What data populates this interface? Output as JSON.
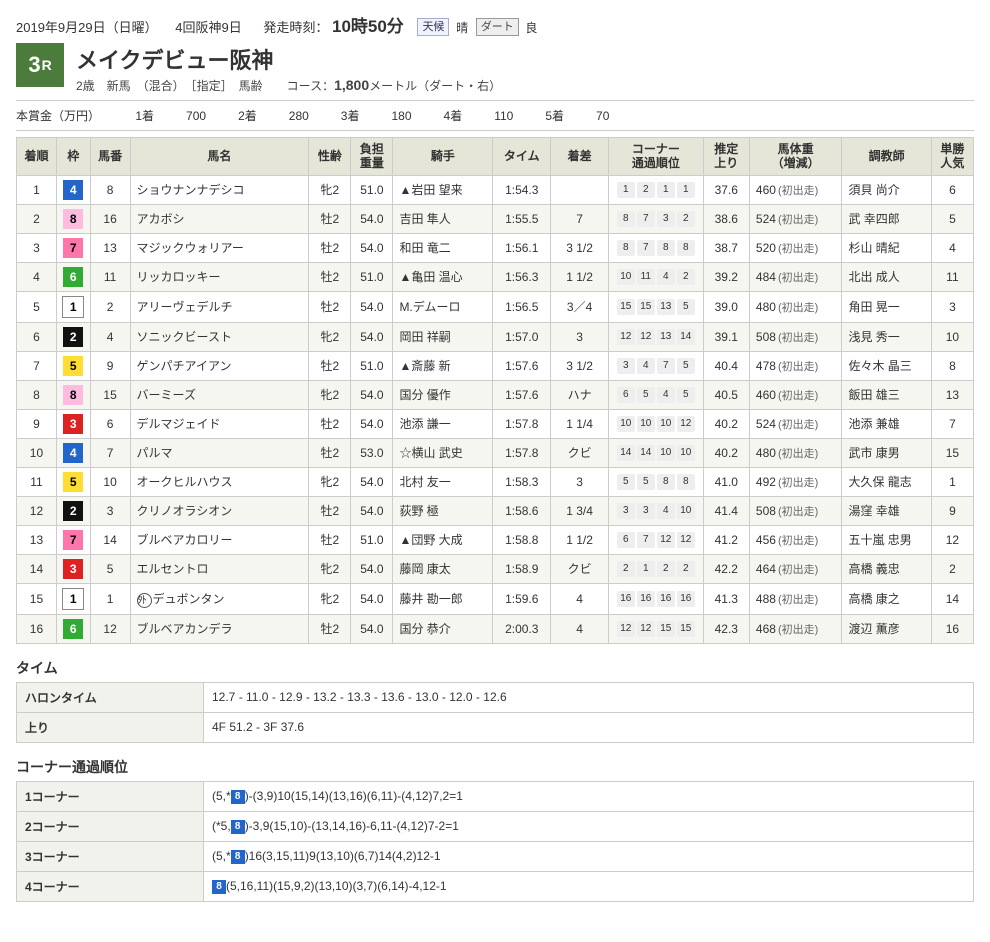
{
  "header": {
    "date": "2019年9月29日（日曜）",
    "meeting": "4回阪神9日",
    "post_label": "発走時刻：",
    "post_time": "10時50分",
    "weather_label": "天候",
    "weather": "晴",
    "surface_label": "ダート",
    "condition": "良"
  },
  "race": {
    "number": "3",
    "suffix": "R",
    "name": "メイクデビュー阪神",
    "subline_pre": "2歳　新馬　（混合）　［指定］　馬齢　　コース：",
    "distance": "1,800",
    "subline_post": "メートル（ダート・右）"
  },
  "prize": {
    "label": "本賞金（万円）",
    "items": [
      {
        "place": "1着",
        "amount": "700"
      },
      {
        "place": "2着",
        "amount": "280"
      },
      {
        "place": "3着",
        "amount": "180"
      },
      {
        "place": "4着",
        "amount": "110"
      },
      {
        "place": "5着",
        "amount": "70"
      }
    ]
  },
  "columns": {
    "finish": "着順",
    "waku": "枠",
    "num": "馬番",
    "name": "馬名",
    "sexage": "性齢",
    "weight": "負担\n重量",
    "jockey": "騎手",
    "time": "タイム",
    "margin": "着差",
    "corner": "コーナー\n通過順位",
    "last": "推定\n上り",
    "bw": "馬体重\n（増減）",
    "trainer": "調教師",
    "pop": "単勝\n人気"
  },
  "rows": [
    {
      "finish": "1",
      "waku": "4",
      "num": "8",
      "name": "ショウナンナデシコ",
      "sexage": "牝2",
      "wt": "51.0",
      "jockey": "▲岩田 望来",
      "time": "1:54.3",
      "margin": "",
      "corner": [
        "1",
        "2",
        "1",
        "1"
      ],
      "last": "37.6",
      "bw": "460",
      "bwnote": "(初出走)",
      "trainer": "須貝 尚介",
      "pop": "6"
    },
    {
      "finish": "2",
      "waku": "8",
      "num": "16",
      "name": "アカボシ",
      "sexage": "牡2",
      "wt": "54.0",
      "jockey": "吉田 隼人",
      "time": "1:55.5",
      "margin": "7",
      "corner": [
        "8",
        "7",
        "3",
        "2"
      ],
      "last": "38.6",
      "bw": "524",
      "bwnote": "(初出走)",
      "trainer": "武 幸四郎",
      "pop": "5"
    },
    {
      "finish": "3",
      "waku": "7",
      "num": "13",
      "name": "マジックウォリアー",
      "sexage": "牡2",
      "wt": "54.0",
      "jockey": "和田 竜二",
      "time": "1:56.1",
      "margin": "3 1/2",
      "corner": [
        "8",
        "7",
        "8",
        "8"
      ],
      "last": "38.7",
      "bw": "520",
      "bwnote": "(初出走)",
      "trainer": "杉山 晴紀",
      "pop": "4"
    },
    {
      "finish": "4",
      "waku": "6",
      "num": "11",
      "name": "リッカロッキー",
      "sexage": "牡2",
      "wt": "51.0",
      "jockey": "▲亀田 温心",
      "time": "1:56.3",
      "margin": "1 1/2",
      "corner": [
        "10",
        "11",
        "4",
        "2"
      ],
      "last": "39.2",
      "bw": "484",
      "bwnote": "(初出走)",
      "trainer": "北出 成人",
      "pop": "11"
    },
    {
      "finish": "5",
      "waku": "1",
      "num": "2",
      "name": "アリーヴェデルチ",
      "sexage": "牡2",
      "wt": "54.0",
      "jockey": "M.デムーロ",
      "time": "1:56.5",
      "margin": "3／4",
      "corner": [
        "15",
        "15",
        "13",
        "5"
      ],
      "last": "39.0",
      "bw": "480",
      "bwnote": "(初出走)",
      "trainer": "角田 晃一",
      "pop": "3"
    },
    {
      "finish": "6",
      "waku": "2",
      "num": "4",
      "name": "ソニックビースト",
      "sexage": "牝2",
      "wt": "54.0",
      "jockey": "岡田 祥嗣",
      "time": "1:57.0",
      "margin": "3",
      "corner": [
        "12",
        "12",
        "13",
        "14"
      ],
      "last": "39.1",
      "bw": "508",
      "bwnote": "(初出走)",
      "trainer": "浅見 秀一",
      "pop": "10"
    },
    {
      "finish": "7",
      "waku": "5",
      "num": "9",
      "name": "ゲンパチアイアン",
      "sexage": "牡2",
      "wt": "51.0",
      "jockey": "▲斎藤 新",
      "time": "1:57.6",
      "margin": "3 1/2",
      "corner": [
        "3",
        "4",
        "7",
        "5"
      ],
      "last": "40.4",
      "bw": "478",
      "bwnote": "(初出走)",
      "trainer": "佐々木 晶三",
      "pop": "8"
    },
    {
      "finish": "8",
      "waku": "8",
      "num": "15",
      "name": "バーミーズ",
      "sexage": "牝2",
      "wt": "54.0",
      "jockey": "国分 優作",
      "time": "1:57.6",
      "margin": "ハナ",
      "corner": [
        "6",
        "5",
        "4",
        "5"
      ],
      "last": "40.5",
      "bw": "460",
      "bwnote": "(初出走)",
      "trainer": "飯田 雄三",
      "pop": "13"
    },
    {
      "finish": "9",
      "waku": "3",
      "num": "6",
      "name": "デルマジェイド",
      "sexage": "牡2",
      "wt": "54.0",
      "jockey": "池添 謙一",
      "time": "1:57.8",
      "margin": "1 1/4",
      "corner": [
        "10",
        "10",
        "10",
        "12"
      ],
      "last": "40.2",
      "bw": "524",
      "bwnote": "(初出走)",
      "trainer": "池添 兼雄",
      "pop": "7"
    },
    {
      "finish": "10",
      "waku": "4",
      "num": "7",
      "name": "パルマ",
      "sexage": "牡2",
      "wt": "53.0",
      "jockey": "☆横山 武史",
      "time": "1:57.8",
      "margin": "クビ",
      "corner": [
        "14",
        "14",
        "10",
        "10"
      ],
      "last": "40.2",
      "bw": "480",
      "bwnote": "(初出走)",
      "trainer": "武市 康男",
      "pop": "15"
    },
    {
      "finish": "11",
      "waku": "5",
      "num": "10",
      "name": "オークヒルハウス",
      "sexage": "牝2",
      "wt": "54.0",
      "jockey": "北村 友一",
      "time": "1:58.3",
      "margin": "3",
      "corner": [
        "5",
        "5",
        "8",
        "8"
      ],
      "last": "41.0",
      "bw": "492",
      "bwnote": "(初出走)",
      "trainer": "大久保 龍志",
      "pop": "1"
    },
    {
      "finish": "12",
      "waku": "2",
      "num": "3",
      "name": "クリノオラシオン",
      "sexage": "牡2",
      "wt": "54.0",
      "jockey": "荻野 極",
      "time": "1:58.6",
      "margin": "1 3/4",
      "corner": [
        "3",
        "3",
        "4",
        "10"
      ],
      "last": "41.4",
      "bw": "508",
      "bwnote": "(初出走)",
      "trainer": "湯窪 幸雄",
      "pop": "9"
    },
    {
      "finish": "13",
      "waku": "7",
      "num": "14",
      "name": "ブルベアカロリー",
      "sexage": "牡2",
      "wt": "51.0",
      "jockey": "▲団野 大成",
      "time": "1:58.8",
      "margin": "1 1/2",
      "corner": [
        "6",
        "7",
        "12",
        "12"
      ],
      "last": "41.2",
      "bw": "456",
      "bwnote": "(初出走)",
      "trainer": "五十嵐 忠男",
      "pop": "12"
    },
    {
      "finish": "14",
      "waku": "3",
      "num": "5",
      "name": "エルセントロ",
      "sexage": "牝2",
      "wt": "54.0",
      "jockey": "藤岡 康太",
      "time": "1:58.9",
      "margin": "クビ",
      "corner": [
        "2",
        "1",
        "2",
        "2"
      ],
      "last": "42.2",
      "bw": "464",
      "bwnote": "(初出走)",
      "trainer": "高橋 義忠",
      "pop": "2"
    },
    {
      "finish": "15",
      "waku": "1",
      "num": "1",
      "name": "デュボンタン",
      "prefix": "外",
      "sexage": "牝2",
      "wt": "54.0",
      "jockey": "藤井 勘一郎",
      "time": "1:59.6",
      "margin": "4",
      "corner": [
        "16",
        "16",
        "16",
        "16"
      ],
      "last": "41.3",
      "bw": "488",
      "bwnote": "(初出走)",
      "trainer": "高橋 康之",
      "pop": "14"
    },
    {
      "finish": "16",
      "waku": "6",
      "num": "12",
      "name": "ブルベアカンデラ",
      "sexage": "牡2",
      "wt": "54.0",
      "jockey": "国分 恭介",
      "time": "2:00.3",
      "margin": "4",
      "corner": [
        "12",
        "12",
        "15",
        "15"
      ],
      "last": "42.3",
      "bw": "468",
      "bwnote": "(初出走)",
      "trainer": "渡辺 薫彦",
      "pop": "16"
    }
  ],
  "time_section": {
    "title": "タイム",
    "furlong_label": "ハロンタイム",
    "furlong": "12.7 - 11.0 - 12.9 - 13.2 - 13.3 - 13.6 - 13.0 - 12.0 - 12.6",
    "agari_label": "上り",
    "agari": "4F 51.2 - 3F 37.6"
  },
  "corner_section": {
    "title": "コーナー通過順位",
    "rows": [
      {
        "label": "1コーナー",
        "pre": "(5,*",
        "waku": "8",
        "post": ")-(3,9)10(15,14)(13,16)(6,11)-(4,12)7,2=1"
      },
      {
        "label": "2コーナー",
        "pre": "(*5,",
        "waku": "8",
        "post": ")-3,9(15,10)-(13,14,16)-6,11-(4,12)7-2=1"
      },
      {
        "label": "3コーナー",
        "pre": "(5,*",
        "waku": "8",
        "post": ")16(3,15,11)9(13,10)(6,7)14(4,2)12-1"
      },
      {
        "label": "4コーナー",
        "pre": "",
        "waku": "8",
        "post": "(5,16,11)(15,9,2)(13,10)(3,7)(6,14)-4,12-1"
      }
    ]
  }
}
